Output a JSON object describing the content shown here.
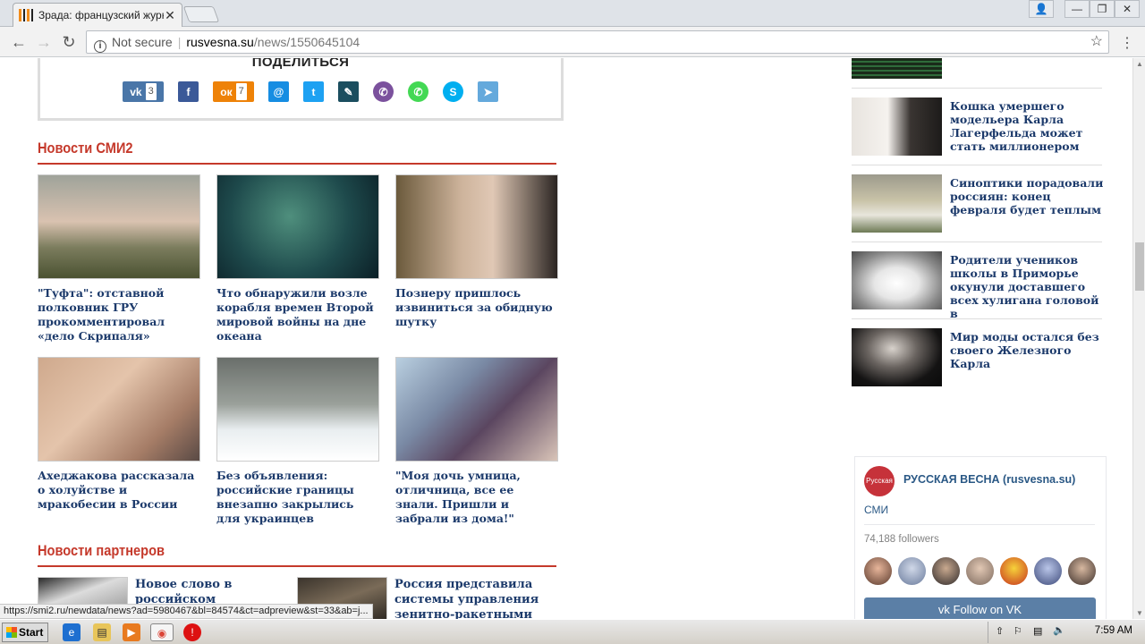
{
  "browser": {
    "tab_title": "Зрада: французский журн",
    "tab_close": "✕",
    "url_security": "Not secure",
    "url_host": "rusvesna.su",
    "url_path": "/news/1550645104",
    "window_buttons": [
      "👤",
      "—",
      "❐",
      "✕"
    ]
  },
  "share": {
    "title": "ПОДЕЛИТЬСЯ",
    "buttons": [
      {
        "icon": "vk-icon",
        "glyph": "vk",
        "count": "3"
      },
      {
        "icon": "facebook-icon",
        "glyph": "f",
        "count": ""
      },
      {
        "icon": "odnoklassniki-icon",
        "glyph": "ок",
        "count": "7"
      },
      {
        "icon": "moimir-icon",
        "glyph": "@",
        "count": ""
      },
      {
        "icon": "twitter-icon",
        "glyph": "t",
        "count": ""
      },
      {
        "icon": "livejournal-icon",
        "glyph": "✎",
        "count": ""
      },
      {
        "icon": "viber-icon",
        "glyph": "✆",
        "count": ""
      },
      {
        "icon": "whatsapp-icon",
        "glyph": "✆",
        "count": ""
      },
      {
        "icon": "skype-icon",
        "glyph": "S",
        "count": ""
      },
      {
        "icon": "telegram-icon",
        "glyph": "➤",
        "count": ""
      }
    ]
  },
  "smi2": {
    "title": "Новости СМИ2",
    "items": [
      {
        "caption": "\"Туфта\": отставной полковник ГРУ прокомментировал «дело Скрипаля»"
      },
      {
        "caption": "Что обнаружили возле корабля времен Второй мировой войны на дне океана"
      },
      {
        "caption": "Познеру пришлось извиниться за обидную шутку"
      },
      {
        "caption": "Ахеджакова рассказала о холуйстве и мракобесии в России"
      },
      {
        "caption": "Без объявления: российские границы внезапно закрылись для украинцев"
      },
      {
        "caption": "\"Моя дочь умница, отличница, все ее знали. Пришли и забрали из дома!\""
      }
    ]
  },
  "partners": {
    "title": "Новости партнеров",
    "items": [
      {
        "caption": "Новое слово в российском"
      },
      {
        "caption": "Россия представила системы управления зенитно-ракетными"
      }
    ]
  },
  "sidebar": {
    "items": [
      {
        "caption": ""
      },
      {
        "caption": "Кошка умершего модельера Карла Лагерфельда может стать миллионером"
      },
      {
        "caption": "Синоптики порадовали россиян: конец февраля будет теплым"
      },
      {
        "caption": "Родители учеников школы в Приморье окунули доставшего всех хулигана головой в"
      },
      {
        "caption": "Мир моды остался без своего Железного Карла"
      }
    ]
  },
  "vk_widget": {
    "name": "РУССКАЯ ВЕСНА (rusvesna.su)",
    "category": "СМИ",
    "followers": "74,188 followers",
    "follow_label": "Follow on VK",
    "avatar_text": "Русская Весна"
  },
  "status_url": "https://smi2.ru/newdata/news?ad=5980467&bl=84574&ct=adpreview&st=33&ab=j...",
  "taskbar": {
    "start_label": "Start",
    "clock": "7:59 AM"
  }
}
